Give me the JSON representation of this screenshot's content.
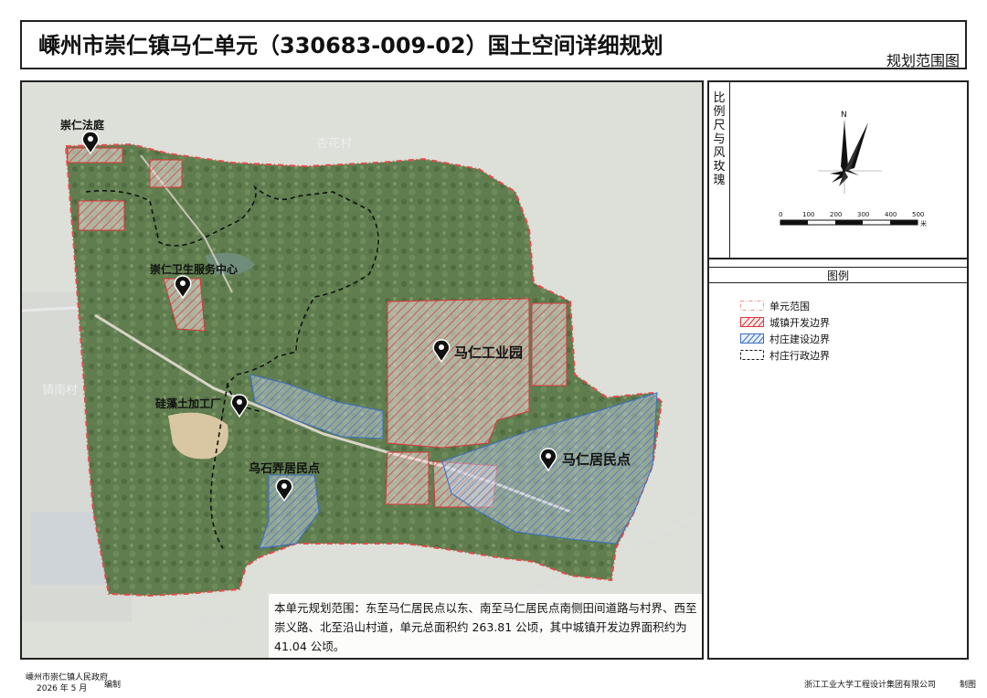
{
  "header": {
    "title": "嵊州市崇仁镇马仁单元（330683-009-02）国土空间详细规划",
    "map_type": "规划范围图"
  },
  "side_panel": {
    "scale_title": "比例尺与风玫瑰",
    "north_label": "N",
    "scale_ticks": [
      "0",
      "100",
      "200",
      "300",
      "400",
      "500"
    ],
    "scale_unit": "米",
    "legend_title": "图例",
    "legend": [
      {
        "label": "单元范围",
        "color": "#e89a8f",
        "style": "dash-dot"
      },
      {
        "label": "城镇开发边界",
        "color": "#d9373a",
        "style": "hatch"
      },
      {
        "label": "村庄建设边界",
        "color": "#3a6fc7",
        "style": "hatch"
      },
      {
        "label": "村庄行政边界",
        "color": "#111111",
        "style": "dashed"
      }
    ]
  },
  "map": {
    "village_labels": [
      "杏花村",
      "镇南村",
      "溪滩村"
    ],
    "pois": [
      {
        "label": "崇仁法庭"
      },
      {
        "label": "崇仁卫生服务中心"
      },
      {
        "label": "马仁工业园"
      },
      {
        "label": "硅藻土加工厂"
      },
      {
        "label": "马仁居民点"
      },
      {
        "label": "乌石弄居民点"
      }
    ],
    "description": "本单元规划范围：东至马仁居民点以东、南至马仁居民点南侧田间道路与村界、西至崇义路、北至沿山村道，单元总面积约 263.81 公顷，其中城镇开发边界面积约为 41.04 公顷。"
  },
  "footer": {
    "issuer": "嵊州市崇仁镇人民政府",
    "date": "2026 年 5 月",
    "issuer_action": "编制",
    "maker": "浙江工业大学工程设计集团有限公司",
    "maker_action": "制图"
  }
}
